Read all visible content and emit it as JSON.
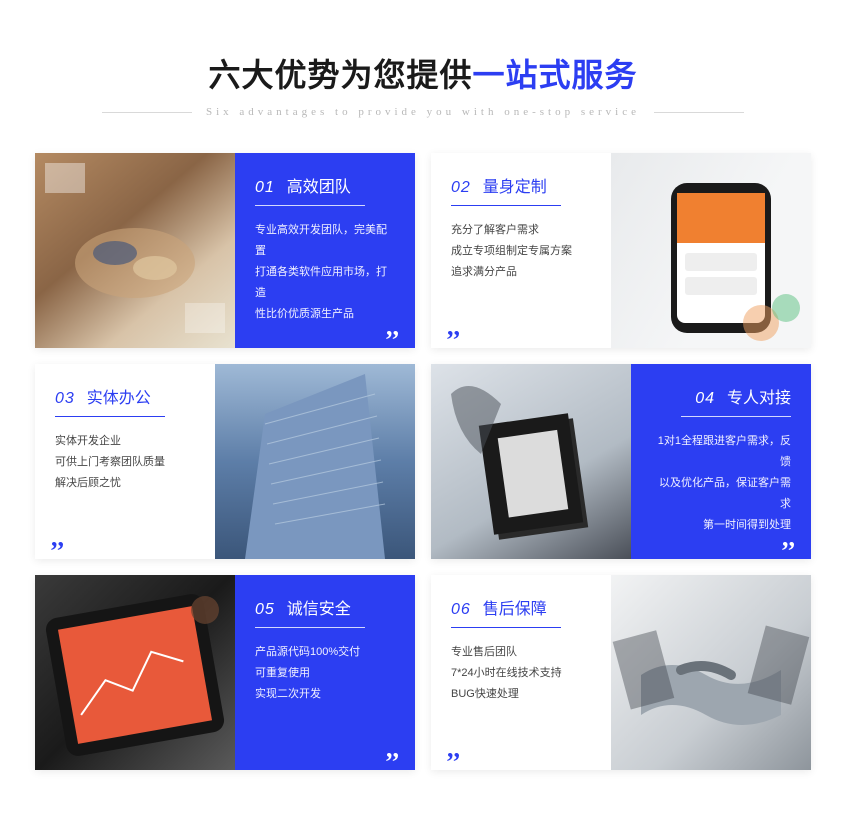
{
  "header": {
    "title_black": "六大优势为您提供",
    "title_blue": "一站式服务",
    "subtitle": "Six advantages to provide you with one-stop service"
  },
  "cards": [
    {
      "num": "01",
      "heading": "高效团队",
      "desc": "专业高效开发团队，完美配置\n打通各类软件应用市场，打造\n性比价优质源生产品"
    },
    {
      "num": "02",
      "heading": "量身定制",
      "desc": "充分了解客户需求\n成立专项组制定专属方案\n追求满分产品"
    },
    {
      "num": "03",
      "heading": "实体办公",
      "desc": "实体开发企业\n可供上门考察团队质量\n解决后顾之忧"
    },
    {
      "num": "04",
      "heading": "专人对接",
      "desc": "1对1全程跟进客户需求，反馈\n以及优化产品，保证客户需求\n第一时间得到处理"
    },
    {
      "num": "05",
      "heading": "诚信安全",
      "desc": "产品源代码100%交付\n可重复使用\n实现二次开发"
    },
    {
      "num": "06",
      "heading": "售后保障",
      "desc": "专业售后团队\n7*24小时在线技术支持\nBUG快速处理"
    }
  ]
}
